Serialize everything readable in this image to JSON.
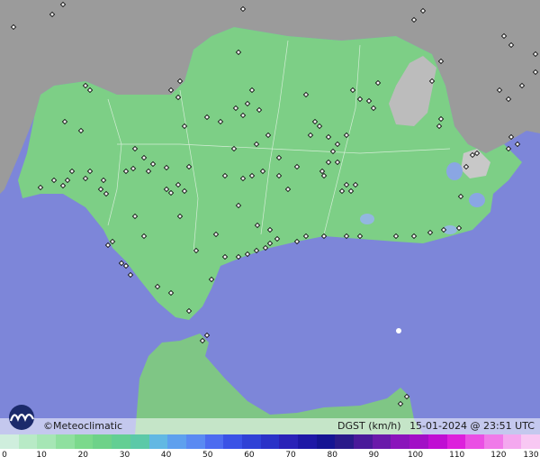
{
  "map": {
    "brand": "©Meteoclimatic",
    "parameter": "DGST (km/h)",
    "datetime": "15-01-2024 @ 23:51 UTC",
    "colors": {
      "sea": "#7d86d9",
      "land": "#7dcf86",
      "outside": "#9a9a9a",
      "mountain": "#bdbdbd",
      "border": "#ffffff"
    }
  },
  "legend": {
    "labels": [
      "0",
      "10",
      "20",
      "30",
      "40",
      "50",
      "60",
      "70",
      "80",
      "90",
      "100",
      "110",
      "120",
      "130"
    ],
    "colors": [
      "#cfeedd",
      "#b8eac6",
      "#a6e6b5",
      "#8fe09f",
      "#7bd98c",
      "#6ed289",
      "#63cf93",
      "#5cc9a8",
      "#62b8e3",
      "#5ea0ee",
      "#5a8af2",
      "#4d6cf0",
      "#3a52e6",
      "#2f41d6",
      "#2a32c8",
      "#2a22b8",
      "#1e18a6",
      "#151493",
      "#2a1a8a",
      "#4a1a9a",
      "#6a1aaa",
      "#8a14bb",
      "#a20fc6",
      "#c00ed3",
      "#dd20dc",
      "#ea4fe4",
      "#f07ae9",
      "#f4a8ef",
      "#f8c8f3"
    ]
  }
}
